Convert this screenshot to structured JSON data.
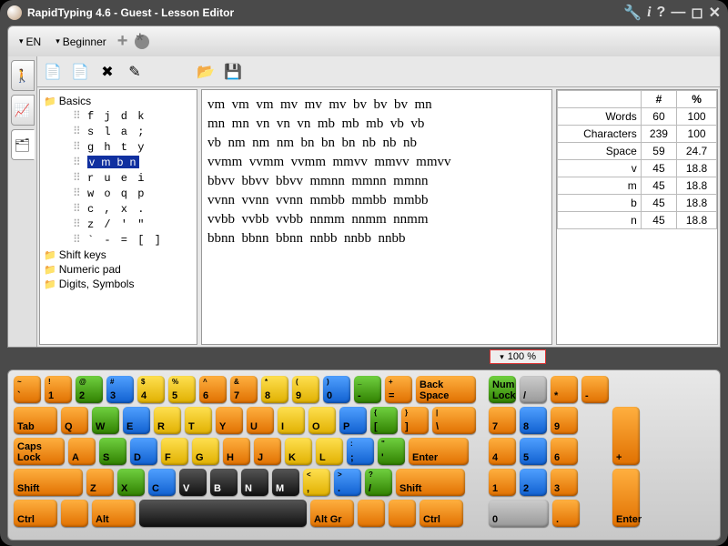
{
  "title": "RapidTyping 4.6 - Guest - Lesson Editor",
  "toolbar": {
    "lang": "EN",
    "level": "Beginner"
  },
  "tree": {
    "root": "Basics",
    "lessons": [
      "f j d k",
      "s l a ;",
      "g h t y",
      "v m b n",
      "r u e i",
      "w o q p",
      "c , x .",
      "z / ' \"",
      "` - = [ ]"
    ],
    "selected_index": 3,
    "folders": [
      "Shift keys",
      "Numeric pad",
      "Digits, Symbols"
    ]
  },
  "lesson_text": "vm  vm  vm  mv  mv  mv  bv  bv  bv  mn\nmn  mn  vn  vn  vn  mb  mb  mb  vb  vb\nvb  nm  nm  nm  bn  bn  bn  nb  nb  nb\nvvmm  vvmm  vvmm  mmvv  mmvv  mmvv\nbbvv  bbvv  bbvv  mmnn  mmnn  mmnn\nvvnn  vvnn  vvnn  mmbb  mmbb  mmbb\nvvbb  vvbb  vvbb  nnmm  nnmm  nnmm\nbbnn  bbnn  bbnn  nnbb  nnbb  nnbb",
  "stats": {
    "headers": [
      "",
      "#",
      "%"
    ],
    "rows": [
      [
        "Words",
        "60",
        "100"
      ],
      [
        "Characters",
        "239",
        "100"
      ],
      [
        "Space",
        "59",
        "24.7"
      ],
      [
        "v",
        "45",
        "18.8"
      ],
      [
        "m",
        "45",
        "18.8"
      ],
      [
        "b",
        "45",
        "18.8"
      ],
      [
        "n",
        "45",
        "18.8"
      ]
    ]
  },
  "zoom": "100 %",
  "keyboard": {
    "row1": [
      [
        "~",
        "`",
        "or"
      ],
      [
        "!",
        "1",
        "or"
      ],
      [
        "@",
        "2",
        "gr"
      ],
      [
        "#",
        "3",
        "bl"
      ],
      [
        "$",
        "4",
        "ye"
      ],
      [
        "%",
        "5",
        "ye"
      ],
      [
        "^",
        "6",
        "or"
      ],
      [
        "&",
        "7",
        "or"
      ],
      [
        "*",
        "8",
        "ye"
      ],
      [
        "(",
        "9",
        "ye"
      ],
      [
        ")",
        "0",
        "bl"
      ],
      [
        "_",
        "-",
        "gr"
      ],
      [
        "+",
        "=",
        "or"
      ],
      [
        "",
        "Back Space",
        "or",
        "kw2"
      ]
    ],
    "row2": [
      [
        "",
        "Tab",
        "or",
        "kw15"
      ],
      [
        "",
        "Q",
        "or"
      ],
      [
        "",
        "W",
        "gr"
      ],
      [
        "",
        "E",
        "bl"
      ],
      [
        "",
        "R",
        "ye"
      ],
      [
        "",
        "T",
        "ye"
      ],
      [
        "",
        "Y",
        "or"
      ],
      [
        "",
        "U",
        "or"
      ],
      [
        "",
        "I",
        "ye"
      ],
      [
        "",
        "O",
        "ye"
      ],
      [
        "",
        "P",
        "bl"
      ],
      [
        "{",
        "[",
        "gr"
      ],
      [
        "}",
        "]",
        "or"
      ],
      [
        "|",
        "\\",
        "or",
        "kw15"
      ]
    ],
    "row3": [
      [
        "",
        "Caps Lock",
        "or",
        "kw175"
      ],
      [
        "",
        "A",
        "or"
      ],
      [
        "",
        "S",
        "gr"
      ],
      [
        "",
        "D",
        "bl"
      ],
      [
        "",
        "F",
        "ye"
      ],
      [
        "",
        "G",
        "ye"
      ],
      [
        "",
        "H",
        "or"
      ],
      [
        "",
        "J",
        "or"
      ],
      [
        "",
        "K",
        "ye"
      ],
      [
        "",
        "L",
        "ye"
      ],
      [
        ":",
        ";",
        "bl"
      ],
      [
        "\"",
        "'",
        "gr"
      ],
      [
        "",
        "Enter",
        "or",
        "kw2"
      ]
    ],
    "row4": [
      [
        "",
        "Shift",
        "or",
        "kw225"
      ],
      [
        "",
        "Z",
        "or"
      ],
      [
        "",
        "X",
        "gr"
      ],
      [
        "",
        "C",
        "bl"
      ],
      [
        "",
        "V",
        "bk"
      ],
      [
        "",
        "B",
        "bk"
      ],
      [
        "",
        "N",
        "bk"
      ],
      [
        "",
        "M",
        "bk"
      ],
      [
        "<",
        ",",
        "ye"
      ],
      [
        ">",
        ".",
        "bl"
      ],
      [
        "?",
        "/",
        "gr"
      ],
      [
        "",
        "Shift",
        "or",
        "kw225"
      ]
    ],
    "row5": [
      [
        "",
        "Ctrl",
        "or",
        "kw15"
      ],
      [
        "",
        "",
        "or"
      ],
      [
        "",
        "Alt",
        "or",
        "kw15"
      ],
      [
        "",
        "",
        "bk",
        "kwспace"
      ],
      [
        "",
        "Alt Gr",
        "or",
        "kw15"
      ],
      [
        "",
        "",
        "or"
      ],
      [
        "",
        "",
        "or"
      ],
      [
        "",
        "Ctrl",
        "or",
        "kw15"
      ]
    ],
    "numpad": [
      [
        [
          "",
          "Num Lock",
          "gr"
        ],
        [
          "",
          "/",
          "gy"
        ],
        [
          "",
          "*",
          "or"
        ],
        [
          "",
          "-",
          "or"
        ]
      ],
      [
        [
          "",
          "7",
          "or"
        ],
        [
          "",
          "8",
          "bl"
        ],
        [
          "",
          "9",
          "or"
        ]
      ],
      [
        [
          "",
          "4",
          "or"
        ],
        [
          "",
          "5",
          "bl"
        ],
        [
          "",
          "6",
          "or"
        ]
      ],
      [
        [
          "",
          "1",
          "or"
        ],
        [
          "",
          "2",
          "bl"
        ],
        [
          "",
          "3",
          "or"
        ]
      ],
      [
        [
          "",
          "0",
          "gy",
          "kw2"
        ],
        [
          "",
          ".",
          "or"
        ]
      ]
    ],
    "numpad_tall": [
      [
        "",
        "+",
        "or"
      ],
      [
        "",
        "Enter",
        "or"
      ]
    ]
  }
}
